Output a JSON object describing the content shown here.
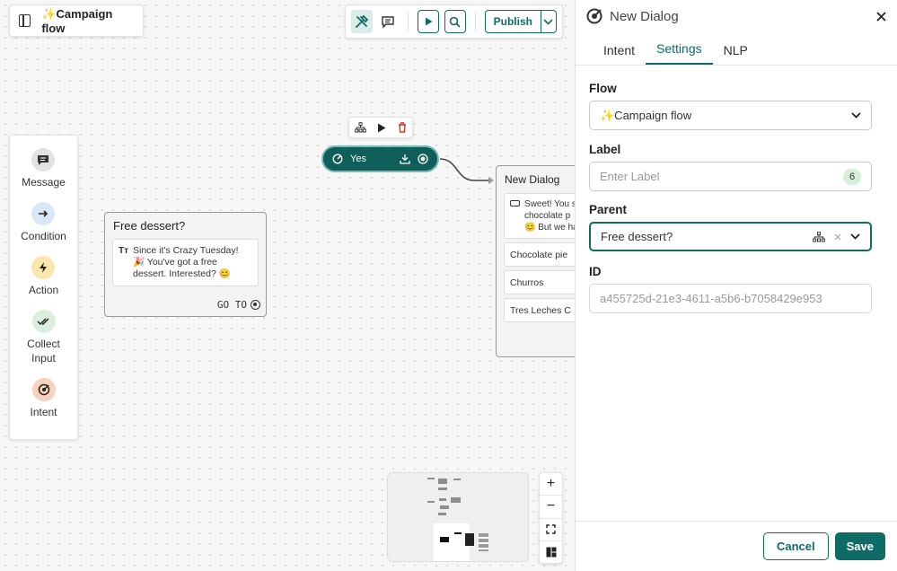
{
  "app": {
    "flow_title": "✨Campaign flow"
  },
  "toolbar": {
    "publish_label": "Publish"
  },
  "palette": {
    "items": [
      {
        "label": "Message",
        "icon": "message-icon",
        "color": "#e5e5e5"
      },
      {
        "label": "Condition",
        "icon": "arrow-right-icon",
        "color": "#dbeaf7"
      },
      {
        "label": "Action",
        "icon": "lightning-icon",
        "color": "#fbe9b7"
      },
      {
        "label": "Collect Input",
        "icon": "double-check-icon",
        "color": "#dff0e3"
      },
      {
        "label": "Intent",
        "icon": "target-icon",
        "color": "#f8d8c3"
      }
    ]
  },
  "nodes": {
    "free_dessert": {
      "title": "Free dessert?",
      "message": "Since it's Crazy Tuesday! 🎉 You've got a free dessert. Interested? 😊",
      "goto": "GO TO"
    },
    "yes": {
      "label": "Yes"
    },
    "new_dialog": {
      "title": "New Dialog",
      "message_lines": [
        "Sweet! You s",
        "chocolate p",
        "😊 But we ha"
      ],
      "options": [
        "Chocolate pie",
        "Churros",
        "Tres Leches C"
      ]
    }
  },
  "panel": {
    "title": "New Dialog",
    "tabs": [
      "Intent",
      "Settings",
      "NLP"
    ],
    "active_tab": "Settings",
    "flow_label": "Flow",
    "flow_value": "✨Campaign flow",
    "label_label": "Label",
    "label_placeholder": "Enter Label",
    "label_count": "6",
    "parent_label": "Parent",
    "parent_value": "Free dessert?",
    "id_label": "ID",
    "id_value": "a455725d-21e3-4611-a5b6-b7058429e953",
    "cancel_label": "Cancel",
    "save_label": "Save"
  },
  "colors": {
    "accent": "#0f6b66",
    "node_dark": "#0f5e5a"
  }
}
